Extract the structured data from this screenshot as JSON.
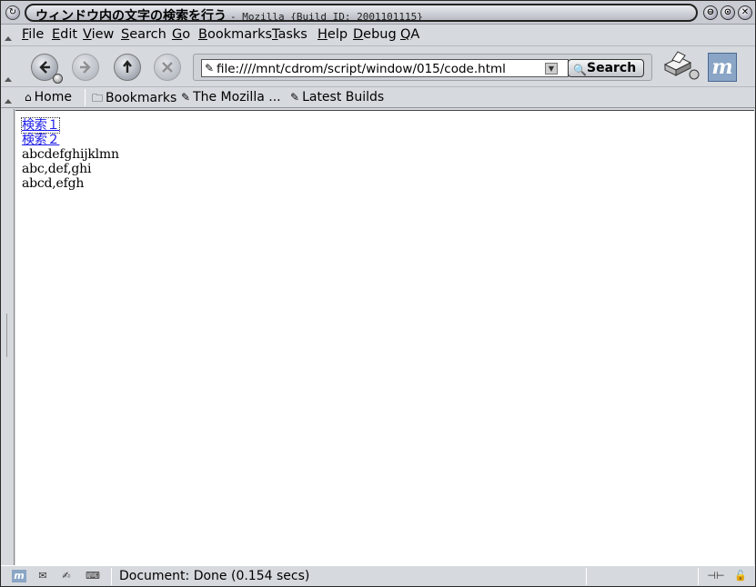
{
  "window": {
    "title": "ウィンドウ内の文字の検索を行う",
    "subtitle": "- Mozilla {Build ID: 2001101115}",
    "controls": {
      "shade": "⊖",
      "maximize": "⊙",
      "close": "✕"
    }
  },
  "menubar": {
    "items": [
      {
        "label": "File",
        "accel": "F"
      },
      {
        "label": "Edit",
        "accel": "E"
      },
      {
        "label": "View",
        "accel": "V"
      },
      {
        "label": "Search",
        "accel": "S"
      },
      {
        "label": "Go",
        "accel": "G"
      },
      {
        "label": "Bookmarks",
        "accel": "B"
      },
      {
        "label": "Tasks",
        "accel": "T"
      },
      {
        "label": "Help",
        "accel": "H"
      },
      {
        "label": "Debug",
        "accel": "D"
      },
      {
        "label": "QA",
        "accel": "Q"
      }
    ]
  },
  "navbar": {
    "back": "back-icon",
    "forward": "forward-icon",
    "reload": "reload-icon",
    "stop": "stop-icon",
    "url": "file:////mnt/cdrom/script/window/015/code.html",
    "search_label": "Search",
    "logo_text": "m"
  },
  "personalbar": {
    "home": "Home",
    "bookmarks": "Bookmarks",
    "mozilla": "The Mozilla ...",
    "latest": "Latest Builds"
  },
  "content": {
    "link1": "検索１",
    "link2": "検索２",
    "line1": "abcdefghijklmn",
    "line2": "abc,def,ghi",
    "line3": "abcd,efgh"
  },
  "statusbar": {
    "text": "Document: Done (0.154 secs)"
  },
  "colors": {
    "link": "#1a1ae8",
    "chrome": "#d6d9de"
  }
}
